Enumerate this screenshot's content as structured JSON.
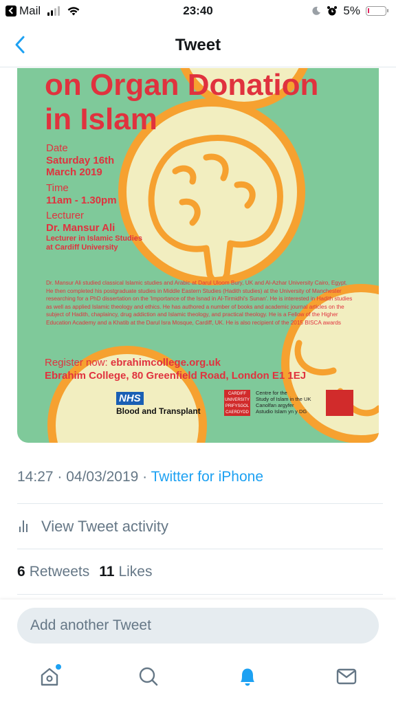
{
  "status_bar": {
    "back_app": "Mail",
    "time": "23:40",
    "battery": "5%"
  },
  "nav": {
    "title": "Tweet"
  },
  "poster": {
    "title_lines": [
      "on Organ Donation",
      "in Islam"
    ],
    "date_label": "Date",
    "date_value_1": "Saturday 16th",
    "date_value_2": "March 2019",
    "time_label": "Time",
    "time_value": "11am - 1.30pm",
    "lecturer_label": "Lecturer",
    "lecturer_name": "Dr. Mansur Ali",
    "lecturer_role_1": "Lecturer in Islamic Studies",
    "lecturer_role_2": "at Cardiff University",
    "bio": "Dr. Mansur Ali studied classical Islamic studies and Arabic at Darul Uloom Bury, UK and Al-Azhar University Cairo, Egypt. He then completed his postgraduate studies in Middle Eastern Studies (Hadith studies) at the University of Manchester researching for a PhD dissertation on the 'Importance of the Isnad in Al-Tirmidhi's Sunan'. He is interested in Hadith studies as well as applied Islamic theology and ethics. He has authored a number of books and academic journal articles on the subject of Hadith, chaplaincy, drug addiction and Islamic theology, and practical theology. He is a Fellow of the Higher Education Academy and a Khatib at the Darul Isra Mosque, Cardiff, UK. He is also recipient of the 2015 BISCA awards",
    "register_prefix": "Register now: ",
    "register_url": "ebrahimcollege.org.uk",
    "address": "Ebrahim College, 80 Greenfield Road, London E1 1EJ",
    "nhs_logo": "NHS",
    "nhs_sub": "Blood and Transplant",
    "cardiff_logo_1": "CARDIFF",
    "cardiff_logo_2": "UNIVERSITY",
    "cardiff_logo_3": "PRIFYSGOL",
    "cardiff_logo_4": "CAERDYDD",
    "cardiff_centre_1": "Centre for the",
    "cardiff_centre_2": "Study of Islam in the UK",
    "cardiff_centre_3": "Canolfan argyfer",
    "cardiff_centre_4": "Astudio Islam yn y DG",
    "colors": {
      "background": "#7fc99a",
      "accent": "#e0323e",
      "circle": "#f6a130"
    }
  },
  "tweet_meta": {
    "timestamp": "14:27 · 04/03/2019 · ",
    "source": "Twitter for iPhone"
  },
  "activity": {
    "label": "View Tweet activity"
  },
  "counts": {
    "retweets_num": "6",
    "retweets_label": "Retweets",
    "likes_num": "11",
    "likes_label": "Likes"
  },
  "compose": {
    "placeholder": "Add another Tweet"
  },
  "tabbar": {
    "tabs": [
      "home-icon",
      "search-icon",
      "notifications-icon",
      "messages-icon"
    ]
  }
}
